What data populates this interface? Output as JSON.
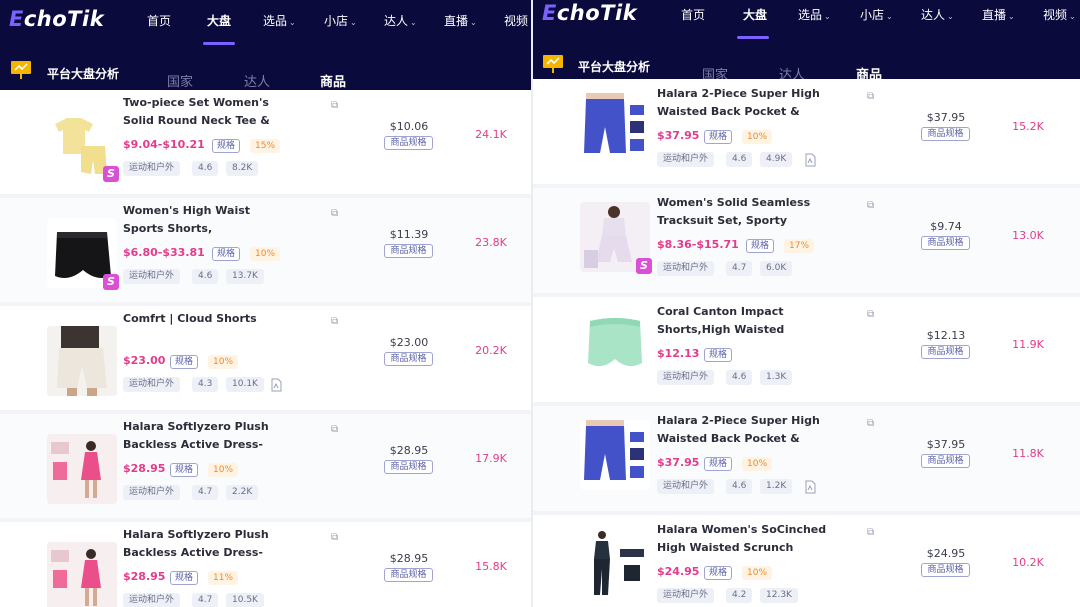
{
  "left": {
    "logo": "EchoTik",
    "nav": [
      {
        "label": "首页",
        "caret": false
      },
      {
        "label": "大盘",
        "caret": false,
        "active": true
      },
      {
        "label": "选品",
        "caret": true
      },
      {
        "label": "小店",
        "caret": true
      },
      {
        "label": "达人",
        "caret": true
      },
      {
        "label": "直播",
        "caret": true
      },
      {
        "label": "视频",
        "caret": false
      }
    ],
    "section_title": "平台大盘分析",
    "subtabs": [
      {
        "label": "国家"
      },
      {
        "label": "达人"
      },
      {
        "label": "商品",
        "active": true
      }
    ],
    "products": [
      {
        "title": "Two-piece Set Women's Solid Round Neck Tee & High Wai...",
        "price": "$9.04-$10.21",
        "spec_label": "规格",
        "commission": "15%",
        "category": "运动和户外",
        "rating": "4.6",
        "reviews": "8.2K",
        "has_doc": false,
        "has_s": true,
        "avg_price": "$10.06",
        "spec_button": "商品规格",
        "sales": "24.1K",
        "thumb": "tee-shorts-set"
      },
      {
        "title": "Women's High Waist Sports Shorts, Breathable...",
        "price": "$6.80-$33.81",
        "spec_label": "规格",
        "commission": "10%",
        "category": "运动和户外",
        "rating": "4.6",
        "reviews": "13.7K",
        "has_doc": false,
        "has_s": true,
        "avg_price": "$11.39",
        "spec_button": "商品规格",
        "sales": "23.8K",
        "thumb": "black-shorts"
      },
      {
        "title": "Comfrt | Cloud Shorts",
        "price": "$23.00",
        "spec_label": "规格",
        "commission": "10%",
        "category": "运动和户外",
        "rating": "4.3",
        "reviews": "10.1K",
        "has_doc": true,
        "has_s": false,
        "avg_price": "$23.00",
        "spec_button": "商品规格",
        "sales": "20.2K",
        "thumb": "cloud-shorts"
      },
      {
        "title": "Halara Softlyzero Plush Backless Active Dress-Easy...",
        "price": "$28.95",
        "spec_label": "规格",
        "commission": "10%",
        "category": "运动和户外",
        "rating": "4.7",
        "reviews": "2.2K",
        "has_doc": false,
        "has_s": false,
        "avg_price": "$28.95",
        "spec_button": "商品规格",
        "sales": "17.9K",
        "thumb": "pink-dress"
      },
      {
        "title": "Halara Softlyzero Plush Backless Active Dress-Easy...",
        "price": "$28.95",
        "spec_label": "规格",
        "commission": "11%",
        "category": "运动和户外",
        "rating": "4.7",
        "reviews": "10.5K",
        "has_doc": false,
        "has_s": false,
        "avg_price": "$28.95",
        "spec_button": "商品规格",
        "sales": "15.8K",
        "thumb": "pink-dress"
      }
    ]
  },
  "right": {
    "logo": "EchoTik",
    "nav": [
      {
        "label": "首页",
        "caret": false
      },
      {
        "label": "大盘",
        "caret": false,
        "active": true
      },
      {
        "label": "选品",
        "caret": true
      },
      {
        "label": "小店",
        "caret": true
      },
      {
        "label": "达人",
        "caret": true
      },
      {
        "label": "直播",
        "caret": true
      },
      {
        "label": "视频",
        "caret": true
      }
    ],
    "section_title": "平台大盘分析",
    "subtabs": [
      {
        "label": "国家"
      },
      {
        "label": "达人"
      },
      {
        "label": "商品",
        "active": true
      }
    ],
    "products": [
      {
        "title": "Halara 2-Piece Super High Waisted Back Pocket & Side...",
        "price": "$37.95",
        "spec_label": "规格",
        "commission": "10%",
        "category": "运动和户外",
        "rating": "4.6",
        "reviews": "4.9K",
        "has_doc": true,
        "has_s": false,
        "avg_price": "$37.95",
        "spec_button": "商品规格",
        "sales": "15.2K",
        "thumb": "blue-shorts"
      },
      {
        "title": "Women's Solid Seamless Tracksuit Set, Sporty Crew...",
        "price": "$8.36-$15.71",
        "spec_label": "规格",
        "commission": "17%",
        "category": "运动和户外",
        "rating": "4.7",
        "reviews": "6.0K",
        "has_doc": false,
        "has_s": true,
        "avg_price": "$9.74",
        "spec_button": "商品规格",
        "sales": "13.0K",
        "thumb": "tracksuit"
      },
      {
        "title": "Coral Canton Impact Shorts,High Waisted Butt...",
        "price": "$12.13",
        "spec_label": "规格",
        "commission": "",
        "category": "运动和户外",
        "rating": "4.6",
        "reviews": "1.3K",
        "has_doc": false,
        "has_s": false,
        "avg_price": "$12.13",
        "spec_button": "商品规格",
        "sales": "11.9K",
        "thumb": "mint-shorts"
      },
      {
        "title": "Halara 2-Piece Super High Waisted Back Pocket & Side...",
        "price": "$37.95",
        "spec_label": "规格",
        "commission": "10%",
        "category": "运动和户外",
        "rating": "4.6",
        "reviews": "1.2K",
        "has_doc": true,
        "has_s": false,
        "avg_price": "$37.95",
        "spec_button": "商品规格",
        "sales": "11.8K",
        "thumb": "blue-shorts"
      },
      {
        "title": "Halara Women's SoCinched High Waisted Scrunch Butt...",
        "price": "$24.95",
        "spec_label": "规格",
        "commission": "10%",
        "category": "运动和户外",
        "rating": "4.2",
        "reviews": "12.3K",
        "has_doc": false,
        "has_s": false,
        "avg_price": "$24.95",
        "spec_button": "商品规格",
        "sales": "10.2K",
        "thumb": "leggings"
      }
    ]
  },
  "colors": {
    "topbar": "#0b0a3d",
    "accent": "#7b61ff",
    "price": "#e23c8c",
    "commission": "#ef8a2d"
  },
  "icons": {
    "section": "presentation-board-icon",
    "copy": "copy-icon",
    "doc": "document-icon",
    "badge": "shop-s-badge"
  }
}
